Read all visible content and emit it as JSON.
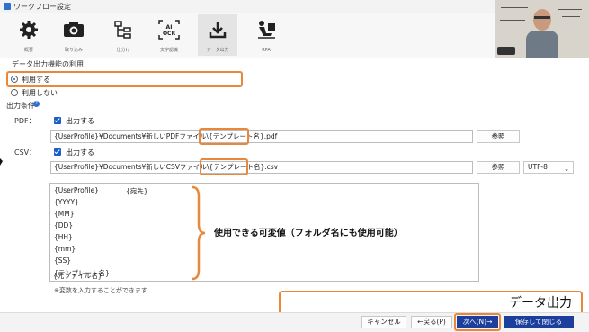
{
  "window": {
    "title": "ワークフロー設定"
  },
  "toolbar": {
    "items": [
      {
        "label": "概要",
        "icon": "gear-icon"
      },
      {
        "label": "取り込み",
        "icon": "camera-icon"
      },
      {
        "label": "仕分け",
        "icon": "tree-icon"
      },
      {
        "label": "文字認識",
        "icon": "ai-ocr-icon",
        "icon_text": "AI\nOCR"
      },
      {
        "label": "データ出力",
        "icon": "download-icon"
      },
      {
        "label": "RPA",
        "icon": "person-desk-icon"
      }
    ]
  },
  "data_output": {
    "section_title": "データ出力機能の利用",
    "use_label": "利用する",
    "not_use_label": "利用しない"
  },
  "conditions": {
    "section_title": "出力条件",
    "pdf": {
      "label": "PDF：",
      "checkbox_label": "出力する",
      "path_prefix": "{UserProfile}¥Documents¥新しいPDFファイル\\",
      "path_template": "{テンプレート名}",
      "path_suffix": ".pdf",
      "browse_label": "参照"
    },
    "csv": {
      "label": "CSV：",
      "checkbox_label": "出力する",
      "path_prefix": "{UserProfile}¥Documents¥新しいCSVファイル\\",
      "path_template": "{テンプレート名}",
      "path_suffix": ".csv",
      "browse_label": "参照",
      "encoding": "UTF-8"
    },
    "variables": [
      "{UserProfile}",
      "{YYYY}",
      "{MM}",
      "{DD}",
      "{HH}",
      "{mm}",
      "{SS}",
      "{テンプレート名}",
      "{元ファイル名}"
    ],
    "variable_extra": "{宛先}",
    "note": "※変数を入力することができます"
  },
  "annotation": {
    "text": "使用できる可変値（フォルダ名にも使用可能）"
  },
  "caption": {
    "text": "データ出力"
  },
  "footer": {
    "cancel_label": "キャンセル",
    "back_label": "←戻る(P)",
    "next_label": "次へ(N)→",
    "save_label": "保存して閉じる"
  },
  "colors": {
    "accent": "#1c3f9e",
    "highlight": "#e8883a",
    "checkbox": "#1a5fc7"
  }
}
